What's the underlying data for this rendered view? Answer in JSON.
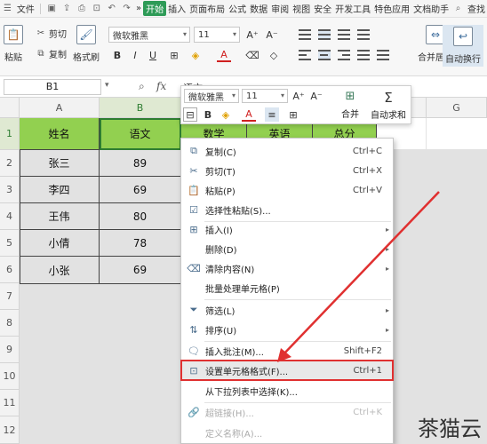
{
  "menubar": {
    "file": "文件",
    "more": "»",
    "tabs": [
      "开始",
      "插入",
      "页面布局",
      "公式",
      "数据",
      "审阅",
      "视图",
      "安全",
      "开发工具",
      "特色应用",
      "文档助手"
    ],
    "active_tab": "开始",
    "search": "查找"
  },
  "ribbon": {
    "paste": "粘贴",
    "cut": "剪切",
    "copy": "复制",
    "format_painter": "格式刷",
    "font_name": "微软雅黑",
    "font_size": "11",
    "bold": "B",
    "italic": "I",
    "underline": "U",
    "font_color_letter": "A",
    "grow_font": "A⁺",
    "shrink_font": "A⁻",
    "merge_center": "合并居中",
    "wrap_text": "自动换行"
  },
  "formula_bar": {
    "name_box": "B1",
    "fx": "fx",
    "content": "语文"
  },
  "columns": [
    "A",
    "B",
    "C",
    "D",
    "E",
    "F",
    "G"
  ],
  "rows": [
    "1",
    "2",
    "3",
    "4",
    "5",
    "6",
    "7",
    "8",
    "9",
    "10",
    "11",
    "12"
  ],
  "table": {
    "headers": [
      "姓名",
      "语文",
      "数学",
      "英语",
      "总分"
    ],
    "rows": [
      [
        "张三",
        "89"
      ],
      [
        "李四",
        "69"
      ],
      [
        "王伟",
        "80"
      ],
      [
        "小倩",
        "78"
      ],
      [
        "小张",
        "69"
      ]
    ]
  },
  "mini_toolbar": {
    "font_name": "微软雅黑",
    "font_size": "11",
    "grow": "A⁺",
    "shrink": "A⁻",
    "bold": "B",
    "font_color": "A",
    "merge": "合并",
    "autosum": "自动求和"
  },
  "context_menu": {
    "items": [
      {
        "label": "复制(C)",
        "shortcut": "Ctrl+C"
      },
      {
        "label": "剪切(T)",
        "shortcut": "Ctrl+X"
      },
      {
        "label": "粘贴(P)",
        "shortcut": "Ctrl+V"
      },
      {
        "label": "选择性粘贴(S)...",
        "shortcut": ""
      },
      {
        "label": "插入(I)",
        "shortcut": ""
      },
      {
        "label": "删除(D)",
        "shortcut": ""
      },
      {
        "label": "清除内容(N)",
        "shortcut": ""
      },
      {
        "label": "批量处理单元格(P)",
        "shortcut": ""
      },
      {
        "label": "筛选(L)",
        "shortcut": ""
      },
      {
        "label": "排序(U)",
        "shortcut": ""
      },
      {
        "label": "插入批注(M)...",
        "shortcut": "Shift+F2"
      },
      {
        "label": "设置单元格格式(F)...",
        "shortcut": "Ctrl+1"
      },
      {
        "label": "从下拉列表中选择(K)...",
        "shortcut": ""
      },
      {
        "label": "超链接(H)...",
        "shortcut": "Ctrl+K"
      },
      {
        "label": "定义名称(A)...",
        "shortcut": ""
      }
    ]
  },
  "watermark": "茶猫云",
  "colors": {
    "header_fill": "#92d050",
    "accent_red": "#e03030",
    "active_tab": "#2e9b57"
  }
}
